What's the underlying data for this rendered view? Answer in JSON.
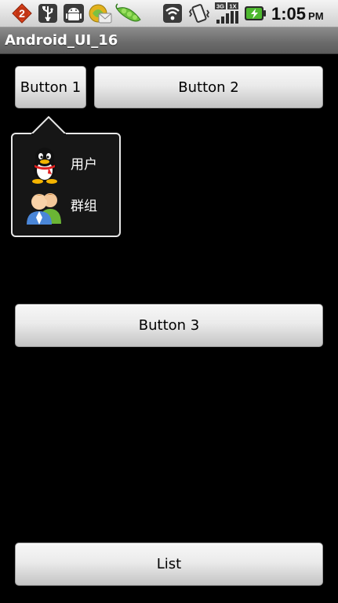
{
  "status_bar": {
    "notification_count": "2",
    "time": "1:05",
    "ampm": "PM",
    "icons": [
      "notification-badge",
      "usb-icon",
      "android-debug-icon",
      "market-update-icon",
      "pea-app-icon",
      "wifi-icon",
      "vibrate-icon",
      "signal-3g-icon",
      "battery-charging-icon"
    ]
  },
  "title_bar": {
    "title": "Android_UI_16"
  },
  "buttons": {
    "button1": "Button 1",
    "button2": "Button 2",
    "button3": "Button 3",
    "list": "List"
  },
  "popup_menu": {
    "items": [
      {
        "label": "用户",
        "icon": "qq-penguin-icon"
      },
      {
        "label": "群组",
        "icon": "group-users-icon"
      }
    ]
  },
  "colors": {
    "background": "#000000",
    "title_bar": "#6a6a6a",
    "button_gradient_top": "#f7f7f7",
    "button_gradient_bottom": "#c4c4c4",
    "popup_background": "#161616",
    "popup_border": "#e8e8e8",
    "notification_badge": "#d9401a"
  }
}
